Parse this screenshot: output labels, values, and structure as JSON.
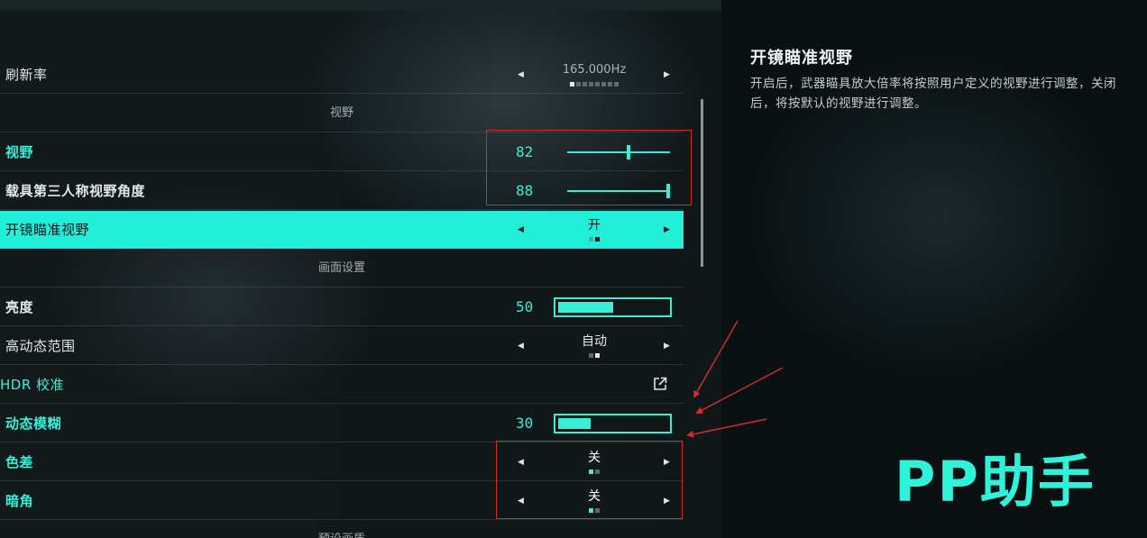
{
  "settings": {
    "refresh_rate": {
      "label": "刷新率",
      "value": "165.000Hz"
    },
    "section_fov": "视野",
    "fov": {
      "label": "视野",
      "value": "82",
      "level": 0.6
    },
    "vehicle_fov": {
      "label": "载具第三人称视野角度",
      "value": "88",
      "level": 1.0
    },
    "ads_fov": {
      "label": "开镜瞄准视野",
      "value": "开"
    },
    "section_display": "画面设置",
    "brightness": {
      "label": "亮度",
      "value": "50",
      "level": 0.5
    },
    "hdr": {
      "label": "高动态范围",
      "value": "自动"
    },
    "hdr_calibration": {
      "label": "HDR 校准"
    },
    "motion_blur": {
      "label": "动态模糊",
      "value": "30",
      "level": 0.3
    },
    "chromatic_aberration": {
      "label": "色差",
      "value": "关"
    },
    "vignette": {
      "label": "暗角",
      "value": "关"
    },
    "section_preset": "预设画质"
  },
  "description": {
    "title": "开镜瞄准视野",
    "body": "开启后，武器瞄具放大倍率将按照用户定义的视野进行调整，关闭后，将按默认的视野进行调整。"
  },
  "watermark": "PP助手",
  "icons": {
    "arrow_left": "◀",
    "arrow_right": "▶",
    "external_link": "external-link-icon"
  },
  "colors": {
    "accent": "#22efd9",
    "annotation": "#d42a2a",
    "background": "#0d1416"
  }
}
